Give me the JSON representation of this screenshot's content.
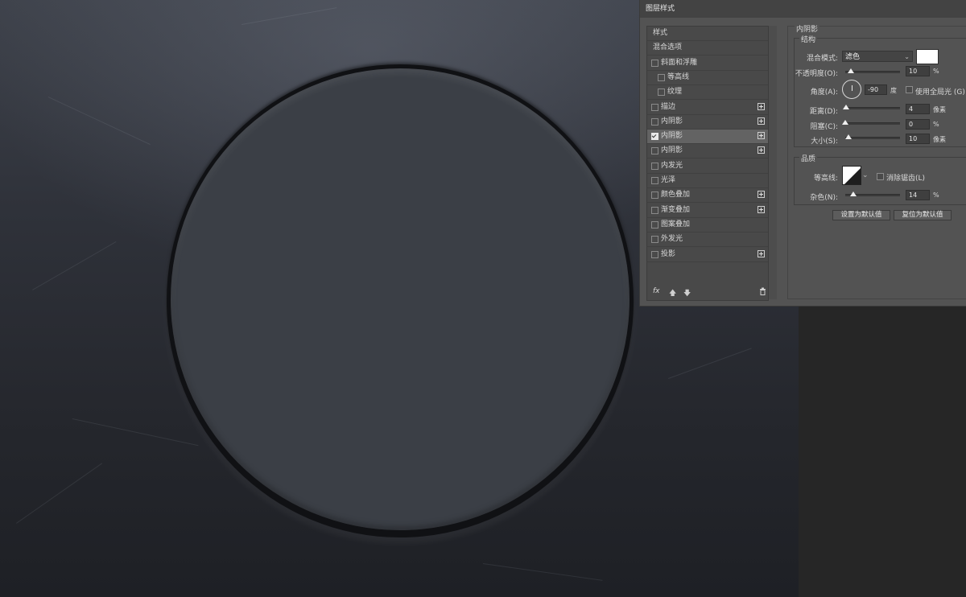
{
  "dialog": {
    "title": "图层样式",
    "styles_list": [
      {
        "label": "样式",
        "checkbox": false,
        "checked": false,
        "plus": false,
        "indent": false
      },
      {
        "label": "混合选项",
        "checkbox": false,
        "checked": false,
        "plus": false,
        "indent": false
      },
      {
        "label": "斜面和浮雕",
        "checkbox": true,
        "checked": false,
        "plus": false,
        "indent": false
      },
      {
        "label": "等高线",
        "checkbox": true,
        "checked": false,
        "plus": false,
        "indent": true
      },
      {
        "label": "纹理",
        "checkbox": true,
        "checked": false,
        "plus": false,
        "indent": true
      },
      {
        "label": "描边",
        "checkbox": true,
        "checked": false,
        "plus": true,
        "indent": false
      },
      {
        "label": "内阴影",
        "checkbox": true,
        "checked": false,
        "plus": true,
        "indent": false
      },
      {
        "label": "内阴影",
        "checkbox": true,
        "checked": true,
        "plus": true,
        "indent": false,
        "selected": true
      },
      {
        "label": "内阴影",
        "checkbox": true,
        "checked": false,
        "plus": true,
        "indent": false
      },
      {
        "label": "内发光",
        "checkbox": true,
        "checked": false,
        "plus": false,
        "indent": false
      },
      {
        "label": "光泽",
        "checkbox": true,
        "checked": false,
        "plus": false,
        "indent": false
      },
      {
        "label": "颜色叠加",
        "checkbox": true,
        "checked": false,
        "plus": true,
        "indent": false
      },
      {
        "label": "渐变叠加",
        "checkbox": true,
        "checked": false,
        "plus": true,
        "indent": false
      },
      {
        "label": "图案叠加",
        "checkbox": true,
        "checked": false,
        "plus": false,
        "indent": false
      },
      {
        "label": "外发光",
        "checkbox": true,
        "checked": false,
        "plus": false,
        "indent": false
      },
      {
        "label": "投影",
        "checkbox": true,
        "checked": false,
        "plus": true,
        "indent": false
      }
    ],
    "fx_label": "fx",
    "panel": {
      "section_title": "内阴影",
      "structure_title": "结构",
      "blend_mode_label": "混合模式:",
      "blend_mode_value": "滤色",
      "blend_color": "#ffffff",
      "opacity_label": "不透明度(O):",
      "opacity_value": "10",
      "opacity_unit": "%",
      "opacity_level": 0.1,
      "angle_label": "角度(A):",
      "angle_value": "-90",
      "angle_unit": "度",
      "global_light_label": "使用全局光 (G)",
      "distance_label": "距离(D):",
      "distance_value": "4",
      "distance_unit": "像素",
      "distance_level": 0.02,
      "choke_label": "阻塞(C):",
      "choke_value": "0",
      "choke_unit": "%",
      "choke_level": 0.0,
      "size_label": "大小(S):",
      "size_value": "10",
      "size_unit": "像素",
      "size_level": 0.06,
      "quality_title": "品质",
      "contour_label": "等高线:",
      "antialias_label": "消除锯齿(L)",
      "noise_label": "杂色(N):",
      "noise_value": "14",
      "noise_unit": "%",
      "noise_level": 0.14,
      "set_default_label": "设置为默认值",
      "reset_default_label": "复位为默认值"
    }
  },
  "colors": {
    "dialog_bg": "#535353",
    "circle_fill": "#3b3f46",
    "background_top": "#3e424b",
    "background_bottom": "#1e2025"
  }
}
